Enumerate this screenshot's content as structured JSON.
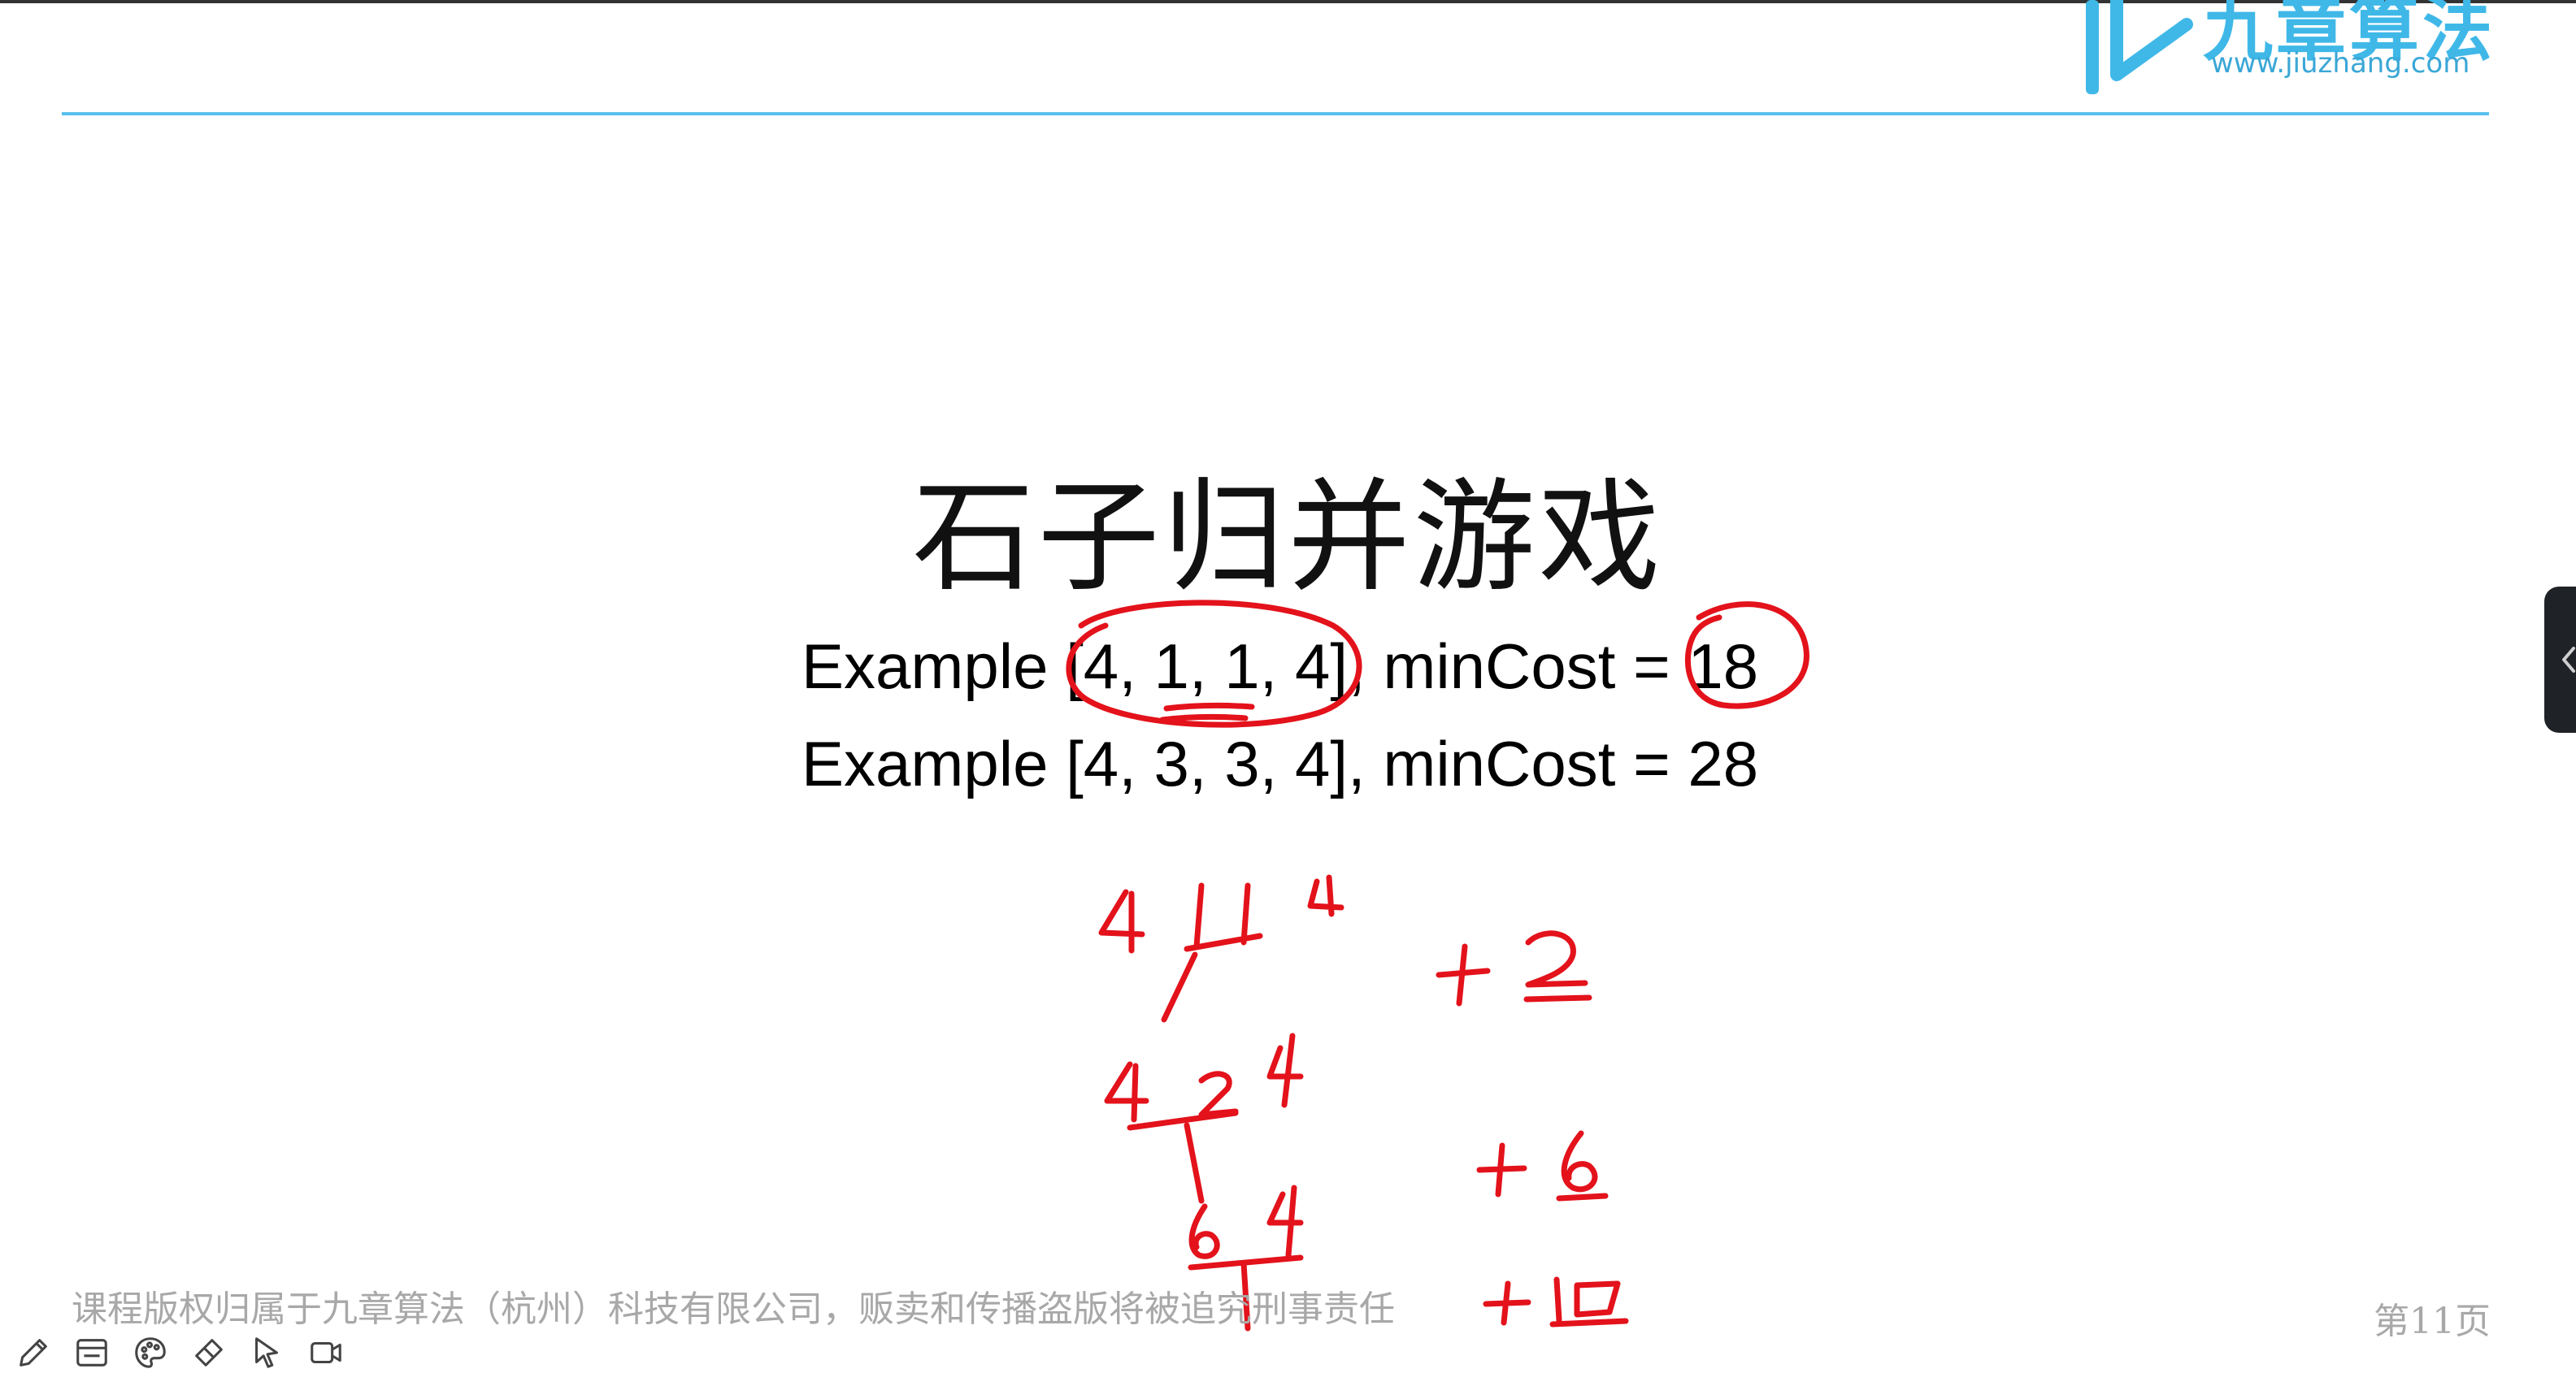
{
  "logo": {
    "name_cn": "九章算法",
    "url_text": "www.jiuzhang.com",
    "brand_color": "#3fb8e8"
  },
  "slide": {
    "title": "石子归并游戏",
    "examples": [
      "Example [4, 1, 1, 4], minCost = 18",
      "Example [4, 3, 3, 4], minCost = 28"
    ]
  },
  "annotations": {
    "ink_color": "#e3121b",
    "row1": "4 1 1 4",
    "row2": "4 2 4",
    "row3": "6 4",
    "cost1": "+2",
    "cost2": "+6",
    "cost3": "+10"
  },
  "footer": {
    "copyright": "课程版权归属于九章算法（杭州）科技有限公司，贩卖和传播盗版将被追究刑事责任",
    "page_number": "第11页"
  },
  "toolbar": {
    "icons": [
      "pencil-icon",
      "window-icon",
      "palette-icon",
      "eraser-icon",
      "pointer-icon",
      "video-camera-icon"
    ]
  },
  "side_panel": {
    "icon": "chevron-left-icon"
  }
}
